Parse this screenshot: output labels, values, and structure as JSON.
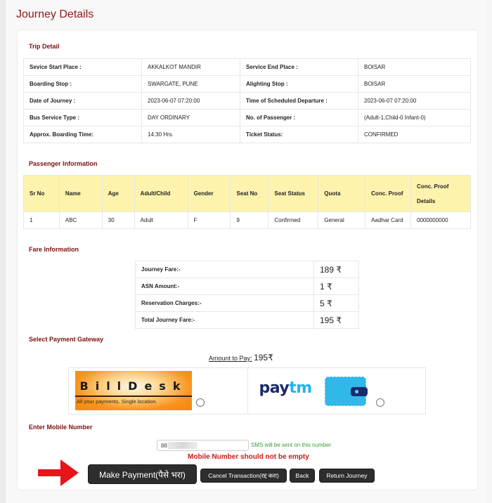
{
  "page": {
    "title": "Journey Details"
  },
  "trip_detail": {
    "title": "Trip Detail",
    "rows": [
      {
        "l1": "Sevice Start Place :",
        "v1": "AKKALKOT MANDIR",
        "l2": "Service End Place :",
        "v2": "BOISAR"
      },
      {
        "l1": "Boarding Stop :",
        "v1": "SWARGATE, PUNE",
        "l2": "Alighting Stop :",
        "v2": "BOISAR"
      },
      {
        "l1": "Date of Journey :",
        "v1": "2023-06-07 07:20:00",
        "l2": "Time of Scheduled Departure :",
        "v2": "2023-06-07 07:20:00"
      },
      {
        "l1": "Bus Service Type :",
        "v1": "DAY ORDINARY",
        "l2": "No. of Passenger :",
        "v2": "(Adult-1,Child-0 Infant-0)"
      },
      {
        "l1": "Approx. Boarding Time:",
        "v1": "14:30 Hrs.",
        "l2": "Ticket Status:",
        "v2": "CONFIRMED"
      }
    ]
  },
  "passenger_info": {
    "title": "Passenger Information",
    "headers": [
      "Sr No",
      "Name",
      "Age",
      "Adult/Child",
      "Gender",
      "Seat No",
      "Seat Status",
      "Quota",
      "Conc. Proof",
      "Conc. Proof Details"
    ],
    "rows": [
      [
        "1",
        "ABC",
        "30",
        "Adult",
        "F",
        "9",
        "Confirmed",
        "General",
        "Aadhar Card",
        "0000000000"
      ]
    ]
  },
  "fare_info": {
    "title": "Fare Information",
    "rows": [
      {
        "label": "Journey Fare:-",
        "value": "189 ₹"
      },
      {
        "label": "ASN Amount:-",
        "value": "1 ₹"
      },
      {
        "label": "Reservation Charges:-",
        "value": "5 ₹"
      },
      {
        "label": "Total Journey Fare:-",
        "value": "195 ₹"
      }
    ]
  },
  "payment_gateway": {
    "title": "Select Payment Gateway",
    "amount_label": "Amount to Pay:",
    "amount_value": "195₹",
    "options": [
      {
        "name": "BillDesk",
        "logo_text": "BillDesk",
        "tagline": "All your payments. Single location.",
        "selected": false
      },
      {
        "name": "Paytm",
        "logo_text_1": "pay",
        "logo_text_2": "tm",
        "selected": false
      }
    ]
  },
  "mobile": {
    "title": "Enter Mobile Number",
    "value": "88",
    "hint": "SMS will be sent on this number",
    "error": "Mobile Number should not be empty"
  },
  "actions": {
    "make_payment": "Make Payment(पैसे भरा)",
    "cancel": "Cancel Transaction(रद्द करा)",
    "back": "Back",
    "return_journey": "Return Journey"
  },
  "colors": {
    "heading": "#8b1a1a",
    "table_header_bg": "#fdf3ad",
    "button_bg": "#2d2d2d",
    "error": "#cc1a1a",
    "hint": "#3a9a3a",
    "annotation_arrow": "#e8141c"
  }
}
